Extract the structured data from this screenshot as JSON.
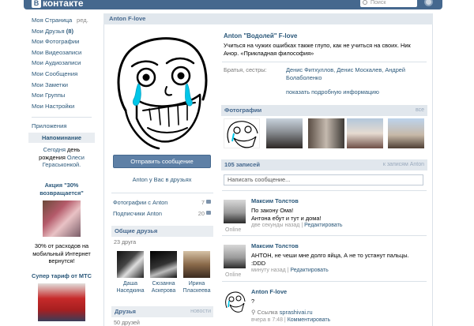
{
  "header": {
    "logo_text": "контакте",
    "search_placeholder": "Поиск",
    "colors": {
      "bar": "#45688e",
      "link": "#2b587a",
      "panel": "#e1e7ed"
    }
  },
  "left_menu": {
    "items": [
      {
        "label": "Моя Страница",
        "extra": "ред."
      },
      {
        "label": "Мои Друзья",
        "count": "(8)"
      },
      {
        "label": "Мои Фотографии"
      },
      {
        "label": "Мои Видеозаписи"
      },
      {
        "label": "Мои Аудиозаписи"
      },
      {
        "label": "Мои Сообщения"
      },
      {
        "label": "Мои Заметки"
      },
      {
        "label": "Мои Группы"
      },
      {
        "label": "Мои Настройки"
      }
    ],
    "apps_label": "Приложения"
  },
  "promos": {
    "reminder": {
      "title": "Напоминание",
      "text_a": "Сегодня",
      "text_b": "день",
      "text_c": "рождения",
      "name": "Олеси Гераськонкой."
    },
    "ad1": {
      "title": "Акция \"30% возвращается\"",
      "text": "30% от расходов на мобильный Интернет вернутся!"
    },
    "ad2": {
      "title": "Супер тариф от МТС"
    }
  },
  "profile": {
    "header_name": "Anton F-love",
    "avatar_icon": "rage-face-avatar",
    "send_message": "Отправить сообщение",
    "in_friends": "Anton у Вас в друзьях",
    "photos_with": {
      "label": "Фотографии с Anton",
      "count": "7"
    },
    "subscribers": {
      "label": "Подписчики Anton",
      "count": "20"
    },
    "common_friends": {
      "title": "Общие друзья",
      "subtitle": "23 друга"
    },
    "friends": [
      {
        "first": "Даша",
        "last": "Наседкина"
      },
      {
        "first": "Сюзанна",
        "last": "Аскерова"
      },
      {
        "first": "Ирина",
        "last": "Пласкеева"
      }
    ],
    "friends_section": {
      "title": "Друзья",
      "right": "новости",
      "subtitle": "50 друзей"
    },
    "full_name": "Anton \"Водолей\" F-love",
    "status": "Учиться на чужих ошибках также глупо, как не учиться на своих. Ник Анор. «Прикладная философия»",
    "siblings_label": "Братья, сестры:",
    "siblings": "Денис Фитхуллов, Денис Москалев, Андрей Болаболенко",
    "more_info": "показать подробную информацию",
    "photos_bar": {
      "title": "Фотографии",
      "right": "все"
    },
    "wall_bar": {
      "title": "105 записей",
      "right": "к записям Anton"
    },
    "wall_placeholder": "Написать сообщение..."
  },
  "posts": [
    {
      "author": "Максим Толстов",
      "lines": [
        "По закону Ома!",
        "Антона ебут и тут и дома!"
      ],
      "online": "Online",
      "meta": "две секунды назад",
      "reply": "Редактировать"
    },
    {
      "author": "Максим Толстов",
      "lines": [
        "АНТОН, не чеши мне долго яйца, А не то устанут пальцы.",
        ":DDD"
      ],
      "online": "Online",
      "meta": "минуту назад",
      "reply": "Редактировать"
    },
    {
      "author": "Anton F-love",
      "lines": [
        "?"
      ],
      "link_label": "Ссылка",
      "link": "sprashivai.ru",
      "meta": "вчера в 7:48",
      "reply": "Комментировать"
    }
  ]
}
